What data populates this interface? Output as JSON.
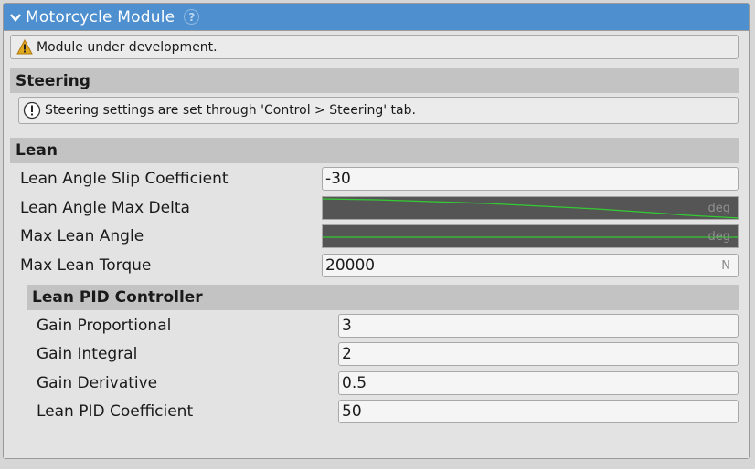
{
  "header": {
    "title": "Motorcycle Module",
    "help_icon": "question-circle-icon",
    "help_glyph": "?"
  },
  "warning": {
    "icon": "warning-triangle-icon",
    "text": "Module under development."
  },
  "steering": {
    "title": "Steering",
    "info_icon": "info-exclamation-icon",
    "info_text": "Steering settings are set through 'Control > Steering' tab."
  },
  "lean": {
    "title": "Lean",
    "slip_coefficient": {
      "label": "Lean Angle Slip Coefficient",
      "value": "-30"
    },
    "max_delta": {
      "label": "Lean Angle Max Delta",
      "unit": "deg"
    },
    "max_angle": {
      "label": "Max Lean Angle",
      "unit": "deg"
    },
    "max_torque": {
      "label": "Max Lean Torque",
      "value": "20000",
      "unit": "N"
    }
  },
  "pid": {
    "title": "Lean PID Controller",
    "gain_proportional": {
      "label": "Gain Proportional",
      "value": "3"
    },
    "gain_integral": {
      "label": "Gain Integral",
      "value": "2"
    },
    "gain_derivative": {
      "label": "Gain Derivative",
      "value": "0.5"
    },
    "coefficient": {
      "label": "Lean PID Coefficient",
      "value": "50"
    }
  },
  "colors": {
    "header": "#4d8fcf",
    "curve_bg": "#555555",
    "curve_line": "#33cc33"
  }
}
